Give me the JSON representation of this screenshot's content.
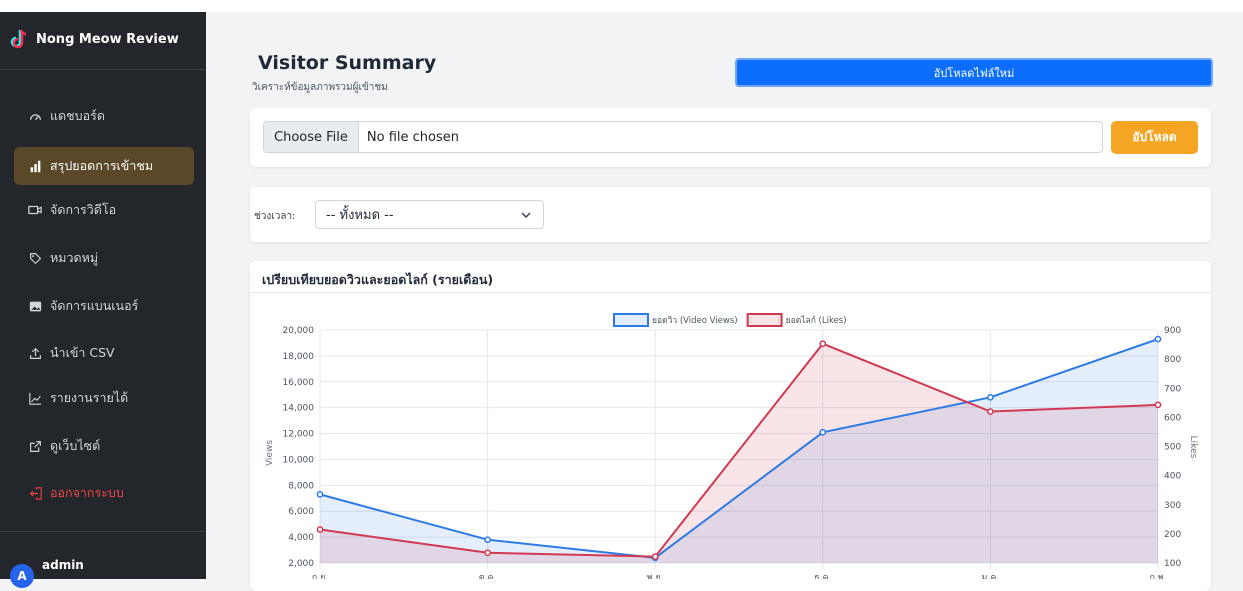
{
  "sidebar": {
    "brand": "Nong Meow Review",
    "items": [
      {
        "label": "แดชบอร์ด",
        "icon": "dashboard-icon"
      },
      {
        "label": "สรุปยอดการเข้าชม",
        "icon": "bar-chart-icon",
        "active": true
      },
      {
        "label": "จัดการวิดีโอ",
        "icon": "video-icon"
      },
      {
        "label": "หมวดหมู่",
        "icon": "tag-icon"
      },
      {
        "label": "จัดการแบนเนอร์",
        "icon": "image-icon"
      },
      {
        "label": "นำเข้า CSV",
        "icon": "upload-icon"
      },
      {
        "label": "รายงานรายได้",
        "icon": "graph-up-icon"
      },
      {
        "label": "ดูเว็บไซต์",
        "icon": "external-link-icon"
      },
      {
        "label": "ออกจากระบบ",
        "icon": "logout-icon"
      }
    ],
    "user": {
      "initial": "A",
      "name": "admin"
    }
  },
  "header": {
    "title": "Visitor Summary",
    "subtitle": "วิเคราะห์ข้อมูลภาพรวมผู้เข้าชม",
    "upload_new_label": "อัปโหลดไฟล์ใหม่"
  },
  "upload": {
    "choose_label": "Choose File",
    "status": "No file chosen",
    "submit_label": "อัปโหลด"
  },
  "filter": {
    "label": "ช่วงเวลา:",
    "selected": "-- ทั้งหมด --"
  },
  "colors": {
    "views": "#2c7be5",
    "likes": "#d0394f",
    "active_nav": "#5b4828",
    "upload_button": "#f5a524",
    "primary_button": "#0d6efd"
  },
  "chart_data": {
    "type": "line",
    "title": "เปรียบเทียบยอดวิวและยอดไลก์ (รายเดือน)",
    "categories": [
      "ก.ย.",
      "ต.ค.",
      "พ.ย.",
      "ธ.ค.",
      "ม.ค.",
      "ก.พ."
    ],
    "series": [
      {
        "name": "ยอดวิว (Video Views)",
        "axis": "left",
        "color": "#2c7be5",
        "values": [
          7300,
          3800,
          2400,
          12100,
          14800,
          19300
        ]
      },
      {
        "name": "ยอดไลก์ (Likes)",
        "axis": "right",
        "color": "#d0394f",
        "values": [
          215,
          135,
          122,
          853,
          620,
          643
        ]
      }
    ],
    "ylabel_left": "Views",
    "ylabel_right": "Likes",
    "ylim_left": [
      2000,
      20000
    ],
    "yticks_left": [
      "2,000",
      "4,000",
      "6,000",
      "8,000",
      "10,000",
      "12,000",
      "14,000",
      "16,000",
      "18,000",
      "20,000"
    ],
    "ylim_right": [
      100,
      900
    ],
    "yticks_right": [
      "100",
      "200",
      "300",
      "400",
      "500",
      "600",
      "700",
      "800",
      "900"
    ],
    "grid": true,
    "legend": "top-center"
  }
}
